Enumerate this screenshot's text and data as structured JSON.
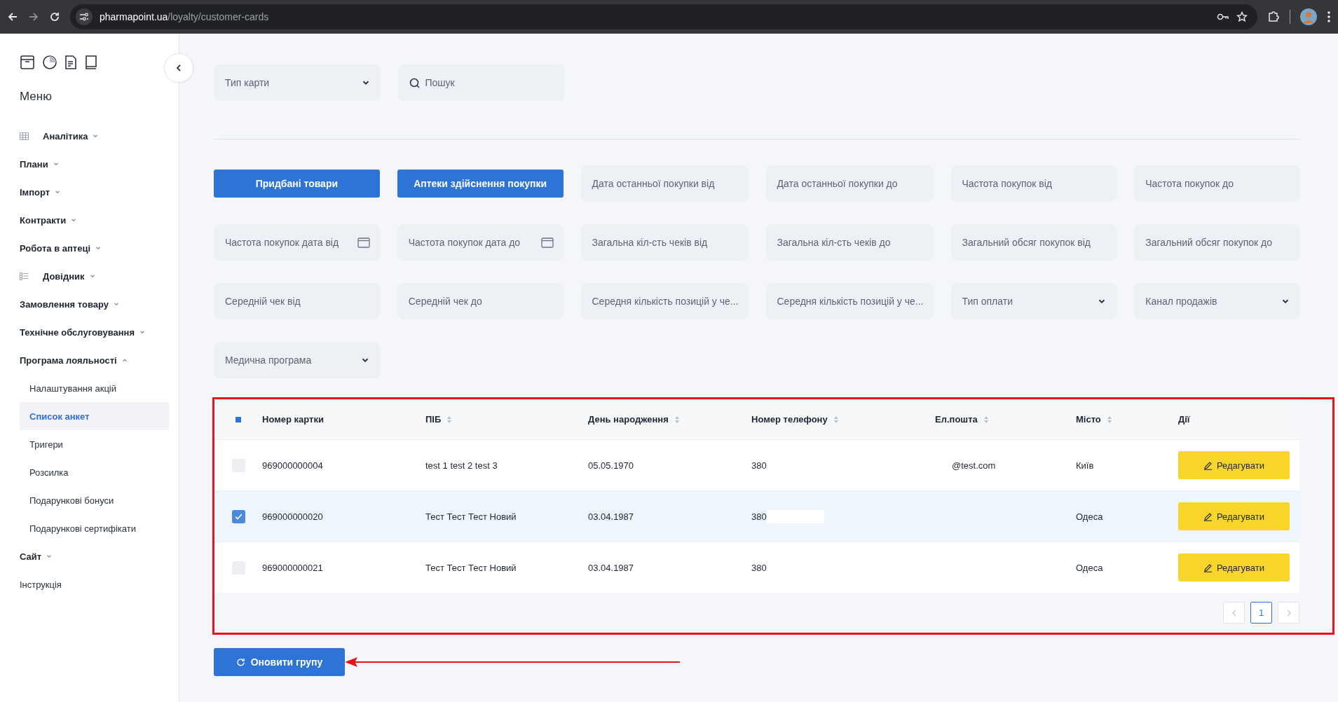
{
  "browser": {
    "host": "pharmapoint.ua",
    "path": "/loyalty/customer-cards"
  },
  "sidebar": {
    "title": "Меню",
    "items": [
      {
        "label": "Аналітика",
        "kind": "table",
        "expanded": false
      },
      {
        "label": "Плани",
        "kind": "plain",
        "expanded": false
      },
      {
        "label": "Імпорт",
        "kind": "plain",
        "expanded": false
      },
      {
        "label": "Контракти",
        "kind": "plain",
        "expanded": false
      },
      {
        "label": "Робота в аптеці",
        "kind": "plain",
        "expanded": false
      },
      {
        "label": "Довідник",
        "kind": "list",
        "expanded": false
      },
      {
        "label": "Замовлення товару",
        "kind": "plain",
        "expanded": false
      },
      {
        "label": "Технічне обслуговування",
        "kind": "plain",
        "expanded": false
      },
      {
        "label": "Програма лояльності",
        "kind": "plain",
        "expanded": true,
        "children": [
          {
            "label": "Налаштування акцій",
            "selected": false
          },
          {
            "label": "Список анкет",
            "selected": true
          },
          {
            "label": "Тригери",
            "selected": false
          },
          {
            "label": "Розсилка",
            "selected": false
          },
          {
            "label": "Подарункові бонуси",
            "selected": false
          },
          {
            "label": "Подарункові сертифікати",
            "selected": false
          }
        ]
      },
      {
        "label": "Сайт",
        "kind": "plain",
        "expanded": false
      },
      {
        "label": "Інструкція",
        "kind": "link"
      }
    ]
  },
  "top_filters": [
    {
      "kind": "select",
      "placeholder": "Тип карти"
    },
    {
      "kind": "search",
      "placeholder": "Пошук"
    }
  ],
  "filters": [
    {
      "kind": "button",
      "label": "Придбані товари"
    },
    {
      "kind": "button",
      "label": "Аптеки здійснення покупки"
    },
    {
      "kind": "input",
      "placeholder": "Дата останньої покупки від"
    },
    {
      "kind": "input",
      "placeholder": "Дата останньої покупки до"
    },
    {
      "kind": "input",
      "placeholder": "Частота покупок від"
    },
    {
      "kind": "input",
      "placeholder": "Частота покупок до"
    },
    {
      "kind": "date",
      "placeholder": "Частота покупок дата від"
    },
    {
      "kind": "date",
      "placeholder": "Частота покупок дата до"
    },
    {
      "kind": "input",
      "placeholder": "Загальна кіл-сть чеків від"
    },
    {
      "kind": "input",
      "placeholder": "Загальна кіл-сть чеків до"
    },
    {
      "kind": "input",
      "placeholder": "Загальний обсяг покупок від"
    },
    {
      "kind": "input",
      "placeholder": "Загальний обсяг покупок до"
    },
    {
      "kind": "input",
      "placeholder": "Середній чек від"
    },
    {
      "kind": "input",
      "placeholder": "Середній чек до"
    },
    {
      "kind": "input",
      "placeholder": "Середня кількість позицій у че..."
    },
    {
      "kind": "input",
      "placeholder": "Середня кількість позицій у че..."
    },
    {
      "kind": "select",
      "placeholder": "Тип оплати"
    },
    {
      "kind": "select",
      "placeholder": "Канал продажів"
    },
    {
      "kind": "select",
      "placeholder": "Медична програма"
    }
  ],
  "table": {
    "select_all": {
      "indeterminate": true
    },
    "columns": [
      {
        "label": "Номер картки",
        "sortable": false
      },
      {
        "label": "ПІБ",
        "sortable": true
      },
      {
        "label": "День народження",
        "sortable": true
      },
      {
        "label": "Номер телефону",
        "sortable": true
      },
      {
        "label": "Ел.пошта",
        "sortable": true
      },
      {
        "label": "Місто",
        "sortable": true
      },
      {
        "label": "Дії",
        "sortable": false
      }
    ],
    "rows": [
      {
        "checked": false,
        "card": "969000000004",
        "name": "test 1 test 2 test 3",
        "birthday": "05.05.1970",
        "phone": "380",
        "email": "@test.com",
        "city": "Київ",
        "action": "Редагувати"
      },
      {
        "checked": true,
        "card": "969000000020",
        "name": "Тест Тест Тест Новий",
        "birthday": "03.04.1987",
        "phone": "380",
        "redacted": true,
        "city": "Одеса",
        "action": "Редагувати"
      },
      {
        "checked": false,
        "card": "969000000021",
        "name": "Тест Тест Тест Новий",
        "birthday": "03.04.1987",
        "phone": "380",
        "city": "Одеса",
        "action": "Редагувати"
      }
    ],
    "pages": [
      {
        "label": "1",
        "selected": true
      }
    ]
  },
  "update_button": {
    "label": "Оновити групу"
  }
}
